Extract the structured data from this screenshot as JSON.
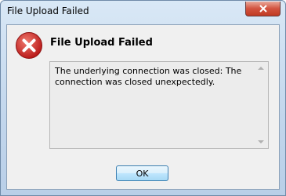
{
  "window": {
    "title": "File Upload Failed"
  },
  "dialog": {
    "heading": "File Upload Failed",
    "message": "The underlying connection was closed: The connection was closed unexpectedly.",
    "ok_label": "OK",
    "icon": "error-icon"
  },
  "colors": {
    "error_red": "#d52b2b",
    "close_button": "#c7452f"
  }
}
